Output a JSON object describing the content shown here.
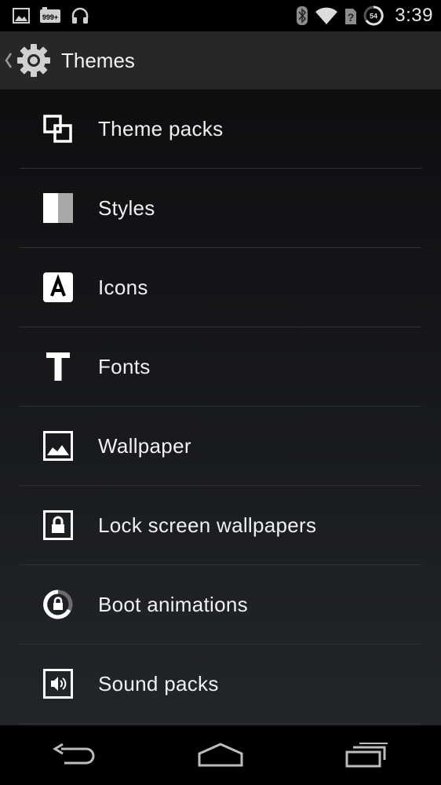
{
  "status_bar": {
    "time": "3:39",
    "notification_badge": "999+",
    "battery_level": "54",
    "icons": [
      "image-icon",
      "counter-badge-icon",
      "headphones-icon",
      "bluetooth-icon",
      "wifi-icon",
      "no-sim-icon",
      "battery-icon"
    ]
  },
  "action_bar": {
    "title": "Themes",
    "icons": [
      "up-caret-icon",
      "settings-gear-icon"
    ]
  },
  "list": {
    "items": [
      {
        "label": "Theme packs",
        "icon": "theme-packs-icon"
      },
      {
        "label": "Styles",
        "icon": "styles-icon"
      },
      {
        "label": "Icons",
        "icon": "icons-icon"
      },
      {
        "label": "Fonts",
        "icon": "fonts-icon"
      },
      {
        "label": "Wallpaper",
        "icon": "wallpaper-icon"
      },
      {
        "label": "Lock screen wallpapers",
        "icon": "lock-screen-icon"
      },
      {
        "label": "Boot animations",
        "icon": "boot-animation-icon"
      },
      {
        "label": "Sound packs",
        "icon": "sound-packs-icon"
      }
    ]
  },
  "nav_bar": {
    "icons": [
      "back-icon",
      "home-icon",
      "recents-icon"
    ]
  },
  "colors": {
    "background": "#000000",
    "action_bar": "#272727",
    "divider": "#2f3135",
    "text": "#f0f0f0"
  }
}
